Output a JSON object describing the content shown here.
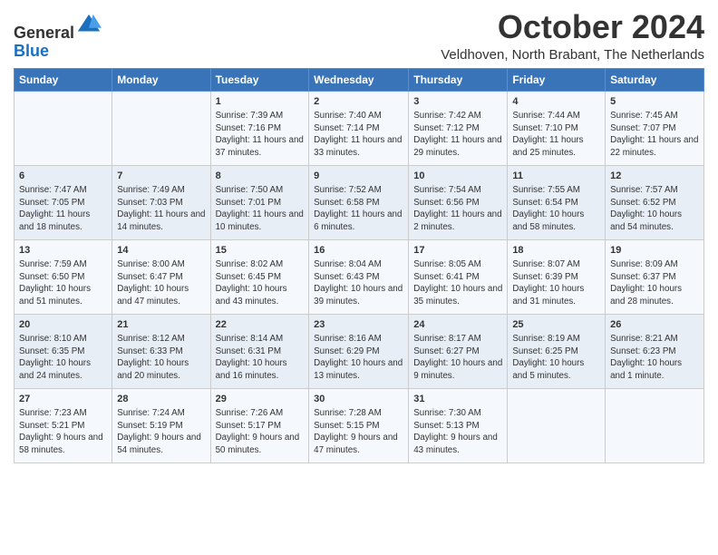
{
  "header": {
    "logo": {
      "line1": "General",
      "line2": "Blue"
    },
    "title": "October 2024",
    "location": "Veldhoven, North Brabant, The Netherlands"
  },
  "weekdays": [
    "Sunday",
    "Monday",
    "Tuesday",
    "Wednesday",
    "Thursday",
    "Friday",
    "Saturday"
  ],
  "weeks": [
    [
      {
        "day": "",
        "info": ""
      },
      {
        "day": "",
        "info": ""
      },
      {
        "day": "1",
        "info": "Sunrise: 7:39 AM\nSunset: 7:16 PM\nDaylight: 11 hours and 37 minutes."
      },
      {
        "day": "2",
        "info": "Sunrise: 7:40 AM\nSunset: 7:14 PM\nDaylight: 11 hours and 33 minutes."
      },
      {
        "day": "3",
        "info": "Sunrise: 7:42 AM\nSunset: 7:12 PM\nDaylight: 11 hours and 29 minutes."
      },
      {
        "day": "4",
        "info": "Sunrise: 7:44 AM\nSunset: 7:10 PM\nDaylight: 11 hours and 25 minutes."
      },
      {
        "day": "5",
        "info": "Sunrise: 7:45 AM\nSunset: 7:07 PM\nDaylight: 11 hours and 22 minutes."
      }
    ],
    [
      {
        "day": "6",
        "info": "Sunrise: 7:47 AM\nSunset: 7:05 PM\nDaylight: 11 hours and 18 minutes."
      },
      {
        "day": "7",
        "info": "Sunrise: 7:49 AM\nSunset: 7:03 PM\nDaylight: 11 hours and 14 minutes."
      },
      {
        "day": "8",
        "info": "Sunrise: 7:50 AM\nSunset: 7:01 PM\nDaylight: 11 hours and 10 minutes."
      },
      {
        "day": "9",
        "info": "Sunrise: 7:52 AM\nSunset: 6:58 PM\nDaylight: 11 hours and 6 minutes."
      },
      {
        "day": "10",
        "info": "Sunrise: 7:54 AM\nSunset: 6:56 PM\nDaylight: 11 hours and 2 minutes."
      },
      {
        "day": "11",
        "info": "Sunrise: 7:55 AM\nSunset: 6:54 PM\nDaylight: 10 hours and 58 minutes."
      },
      {
        "day": "12",
        "info": "Sunrise: 7:57 AM\nSunset: 6:52 PM\nDaylight: 10 hours and 54 minutes."
      }
    ],
    [
      {
        "day": "13",
        "info": "Sunrise: 7:59 AM\nSunset: 6:50 PM\nDaylight: 10 hours and 51 minutes."
      },
      {
        "day": "14",
        "info": "Sunrise: 8:00 AM\nSunset: 6:47 PM\nDaylight: 10 hours and 47 minutes."
      },
      {
        "day": "15",
        "info": "Sunrise: 8:02 AM\nSunset: 6:45 PM\nDaylight: 10 hours and 43 minutes."
      },
      {
        "day": "16",
        "info": "Sunrise: 8:04 AM\nSunset: 6:43 PM\nDaylight: 10 hours and 39 minutes."
      },
      {
        "day": "17",
        "info": "Sunrise: 8:05 AM\nSunset: 6:41 PM\nDaylight: 10 hours and 35 minutes."
      },
      {
        "day": "18",
        "info": "Sunrise: 8:07 AM\nSunset: 6:39 PM\nDaylight: 10 hours and 31 minutes."
      },
      {
        "day": "19",
        "info": "Sunrise: 8:09 AM\nSunset: 6:37 PM\nDaylight: 10 hours and 28 minutes."
      }
    ],
    [
      {
        "day": "20",
        "info": "Sunrise: 8:10 AM\nSunset: 6:35 PM\nDaylight: 10 hours and 24 minutes."
      },
      {
        "day": "21",
        "info": "Sunrise: 8:12 AM\nSunset: 6:33 PM\nDaylight: 10 hours and 20 minutes."
      },
      {
        "day": "22",
        "info": "Sunrise: 8:14 AM\nSunset: 6:31 PM\nDaylight: 10 hours and 16 minutes."
      },
      {
        "day": "23",
        "info": "Sunrise: 8:16 AM\nSunset: 6:29 PM\nDaylight: 10 hours and 13 minutes."
      },
      {
        "day": "24",
        "info": "Sunrise: 8:17 AM\nSunset: 6:27 PM\nDaylight: 10 hours and 9 minutes."
      },
      {
        "day": "25",
        "info": "Sunrise: 8:19 AM\nSunset: 6:25 PM\nDaylight: 10 hours and 5 minutes."
      },
      {
        "day": "26",
        "info": "Sunrise: 8:21 AM\nSunset: 6:23 PM\nDaylight: 10 hours and 1 minute."
      }
    ],
    [
      {
        "day": "27",
        "info": "Sunrise: 7:23 AM\nSunset: 5:21 PM\nDaylight: 9 hours and 58 minutes."
      },
      {
        "day": "28",
        "info": "Sunrise: 7:24 AM\nSunset: 5:19 PM\nDaylight: 9 hours and 54 minutes."
      },
      {
        "day": "29",
        "info": "Sunrise: 7:26 AM\nSunset: 5:17 PM\nDaylight: 9 hours and 50 minutes."
      },
      {
        "day": "30",
        "info": "Sunrise: 7:28 AM\nSunset: 5:15 PM\nDaylight: 9 hours and 47 minutes."
      },
      {
        "day": "31",
        "info": "Sunrise: 7:30 AM\nSunset: 5:13 PM\nDaylight: 9 hours and 43 minutes."
      },
      {
        "day": "",
        "info": ""
      },
      {
        "day": "",
        "info": ""
      }
    ]
  ]
}
